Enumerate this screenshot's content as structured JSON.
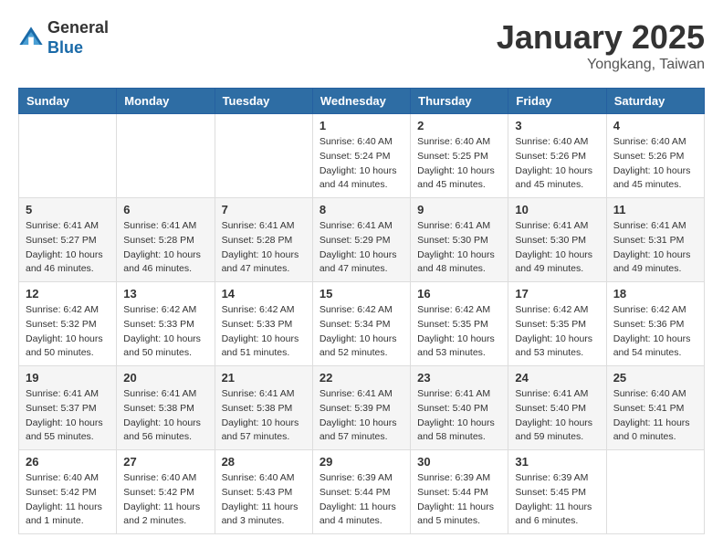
{
  "header": {
    "logo_line1": "General",
    "logo_line2": "Blue",
    "month_title": "January 2025",
    "location": "Yongkang, Taiwan"
  },
  "days_of_week": [
    "Sunday",
    "Monday",
    "Tuesday",
    "Wednesday",
    "Thursday",
    "Friday",
    "Saturday"
  ],
  "weeks": [
    [
      {
        "day": "",
        "info": ""
      },
      {
        "day": "",
        "info": ""
      },
      {
        "day": "",
        "info": ""
      },
      {
        "day": "1",
        "info": "Sunrise: 6:40 AM\nSunset: 5:24 PM\nDaylight: 10 hours\nand 44 minutes."
      },
      {
        "day": "2",
        "info": "Sunrise: 6:40 AM\nSunset: 5:25 PM\nDaylight: 10 hours\nand 45 minutes."
      },
      {
        "day": "3",
        "info": "Sunrise: 6:40 AM\nSunset: 5:26 PM\nDaylight: 10 hours\nand 45 minutes."
      },
      {
        "day": "4",
        "info": "Sunrise: 6:40 AM\nSunset: 5:26 PM\nDaylight: 10 hours\nand 45 minutes."
      }
    ],
    [
      {
        "day": "5",
        "info": "Sunrise: 6:41 AM\nSunset: 5:27 PM\nDaylight: 10 hours\nand 46 minutes."
      },
      {
        "day": "6",
        "info": "Sunrise: 6:41 AM\nSunset: 5:28 PM\nDaylight: 10 hours\nand 46 minutes."
      },
      {
        "day": "7",
        "info": "Sunrise: 6:41 AM\nSunset: 5:28 PM\nDaylight: 10 hours\nand 47 minutes."
      },
      {
        "day": "8",
        "info": "Sunrise: 6:41 AM\nSunset: 5:29 PM\nDaylight: 10 hours\nand 47 minutes."
      },
      {
        "day": "9",
        "info": "Sunrise: 6:41 AM\nSunset: 5:30 PM\nDaylight: 10 hours\nand 48 minutes."
      },
      {
        "day": "10",
        "info": "Sunrise: 6:41 AM\nSunset: 5:30 PM\nDaylight: 10 hours\nand 49 minutes."
      },
      {
        "day": "11",
        "info": "Sunrise: 6:41 AM\nSunset: 5:31 PM\nDaylight: 10 hours\nand 49 minutes."
      }
    ],
    [
      {
        "day": "12",
        "info": "Sunrise: 6:42 AM\nSunset: 5:32 PM\nDaylight: 10 hours\nand 50 minutes."
      },
      {
        "day": "13",
        "info": "Sunrise: 6:42 AM\nSunset: 5:33 PM\nDaylight: 10 hours\nand 50 minutes."
      },
      {
        "day": "14",
        "info": "Sunrise: 6:42 AM\nSunset: 5:33 PM\nDaylight: 10 hours\nand 51 minutes."
      },
      {
        "day": "15",
        "info": "Sunrise: 6:42 AM\nSunset: 5:34 PM\nDaylight: 10 hours\nand 52 minutes."
      },
      {
        "day": "16",
        "info": "Sunrise: 6:42 AM\nSunset: 5:35 PM\nDaylight: 10 hours\nand 53 minutes."
      },
      {
        "day": "17",
        "info": "Sunrise: 6:42 AM\nSunset: 5:35 PM\nDaylight: 10 hours\nand 53 minutes."
      },
      {
        "day": "18",
        "info": "Sunrise: 6:42 AM\nSunset: 5:36 PM\nDaylight: 10 hours\nand 54 minutes."
      }
    ],
    [
      {
        "day": "19",
        "info": "Sunrise: 6:41 AM\nSunset: 5:37 PM\nDaylight: 10 hours\nand 55 minutes."
      },
      {
        "day": "20",
        "info": "Sunrise: 6:41 AM\nSunset: 5:38 PM\nDaylight: 10 hours\nand 56 minutes."
      },
      {
        "day": "21",
        "info": "Sunrise: 6:41 AM\nSunset: 5:38 PM\nDaylight: 10 hours\nand 57 minutes."
      },
      {
        "day": "22",
        "info": "Sunrise: 6:41 AM\nSunset: 5:39 PM\nDaylight: 10 hours\nand 57 minutes."
      },
      {
        "day": "23",
        "info": "Sunrise: 6:41 AM\nSunset: 5:40 PM\nDaylight: 10 hours\nand 58 minutes."
      },
      {
        "day": "24",
        "info": "Sunrise: 6:41 AM\nSunset: 5:40 PM\nDaylight: 10 hours\nand 59 minutes."
      },
      {
        "day": "25",
        "info": "Sunrise: 6:40 AM\nSunset: 5:41 PM\nDaylight: 11 hours\nand 0 minutes."
      }
    ],
    [
      {
        "day": "26",
        "info": "Sunrise: 6:40 AM\nSunset: 5:42 PM\nDaylight: 11 hours\nand 1 minute."
      },
      {
        "day": "27",
        "info": "Sunrise: 6:40 AM\nSunset: 5:42 PM\nDaylight: 11 hours\nand 2 minutes."
      },
      {
        "day": "28",
        "info": "Sunrise: 6:40 AM\nSunset: 5:43 PM\nDaylight: 11 hours\nand 3 minutes."
      },
      {
        "day": "29",
        "info": "Sunrise: 6:39 AM\nSunset: 5:44 PM\nDaylight: 11 hours\nand 4 minutes."
      },
      {
        "day": "30",
        "info": "Sunrise: 6:39 AM\nSunset: 5:44 PM\nDaylight: 11 hours\nand 5 minutes."
      },
      {
        "day": "31",
        "info": "Sunrise: 6:39 AM\nSunset: 5:45 PM\nDaylight: 11 hours\nand 6 minutes."
      },
      {
        "day": "",
        "info": ""
      }
    ]
  ]
}
